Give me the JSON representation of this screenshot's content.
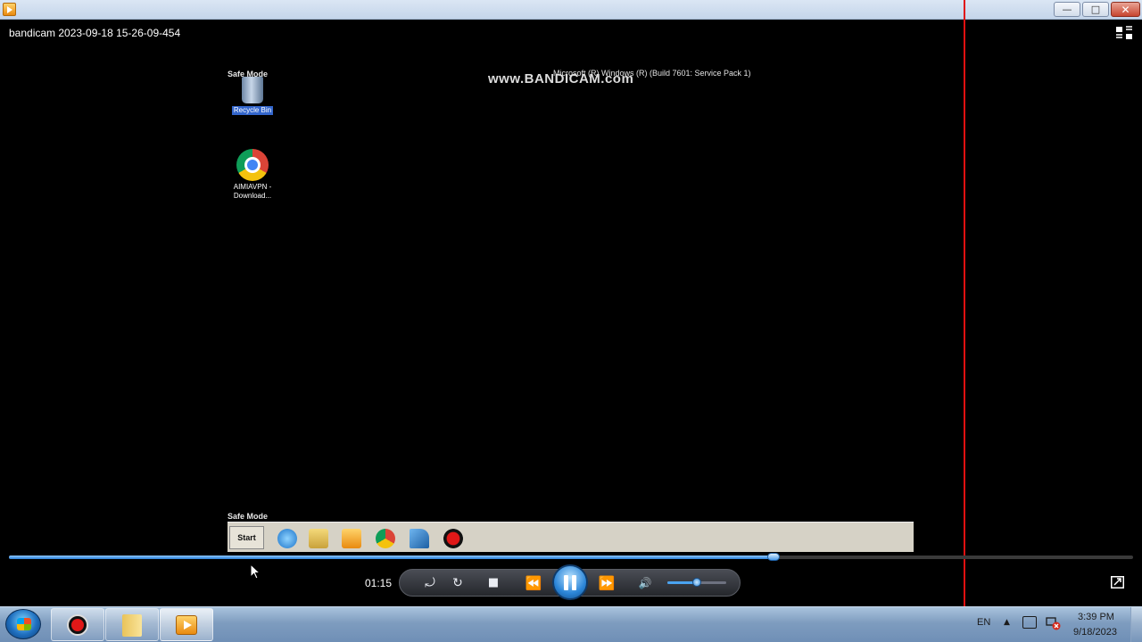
{
  "window": {
    "title": "",
    "controls": {
      "minimize": "—",
      "maximize": "□",
      "close": "✕"
    }
  },
  "player": {
    "video_title": "bandicam 2023-09-18 15-26-09-454",
    "current_time": "01:15",
    "progress_fraction": 0.68,
    "volume_fraction": 0.5,
    "accent_color": "#2a7fd6",
    "buttons": {
      "shuffle_icon": "⤾",
      "repeat_icon": "↻",
      "stop_icon": "■",
      "prev_icon": "⏪",
      "next_icon": "⏩",
      "volume_icon": "🔊"
    }
  },
  "video_frame": {
    "safe_mode_top": "Safe Mode",
    "safe_mode_bottom": "Safe Mode",
    "watermark": "www.BANDICAM.com",
    "build_text": "Microsoft (R) Windows (R) (Build 7601: Service Pack 1)",
    "desktop_icons": [
      {
        "label": "Recycle Bin",
        "icon": "recycle-bin-icon"
      },
      {
        "label": "AIMIAVPN - Download...",
        "icon": "chrome-icon"
      }
    ],
    "inner_taskbar": {
      "start_label": "Start",
      "icons": [
        "ie-icon",
        "explorer-icon",
        "player-icon",
        "chrome-icon",
        "vpn-icon",
        "bandicam-icon"
      ]
    }
  },
  "taskbar": {
    "pinned": [
      "bandicam-icon",
      "explorer-folder-icon",
      "player-icon"
    ],
    "language": "EN",
    "clock_time": "3:39 PM",
    "clock_date": "9/18/2023"
  }
}
